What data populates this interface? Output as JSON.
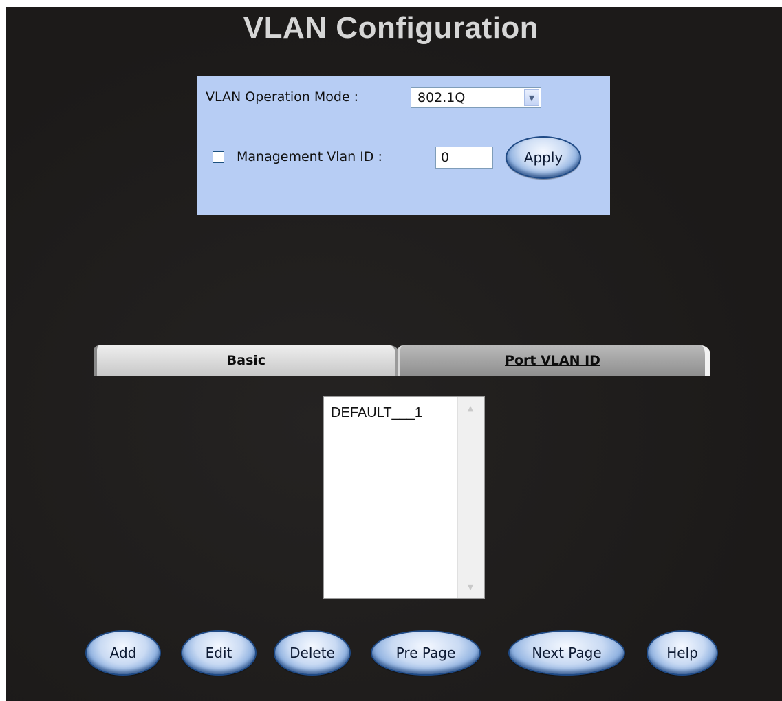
{
  "page": {
    "title": "VLAN Configuration"
  },
  "config": {
    "mode_label": "VLAN Operation Mode :",
    "mode_value": "802.1Q",
    "mgmt_label": "Management Vlan ID :",
    "mgmt_checked": false,
    "mgmt_value": "0",
    "apply_label": "Apply"
  },
  "tabs": [
    {
      "label": "Basic",
      "active": false
    },
    {
      "label": "Port VLAN ID",
      "active": true
    }
  ],
  "vlan_list": {
    "items": [
      "DEFAULT___1"
    ]
  },
  "actions": {
    "add": "Add",
    "edit": "Edit",
    "delete": "Delete",
    "pre_page": "Pre Page",
    "next_page": "Next Page",
    "help": "Help"
  },
  "colors": {
    "background": "#1e1c1b",
    "config_box": "#b7cdf4",
    "title": "#d6d6d6"
  },
  "icons": {
    "select_arrow": "chevron-down-icon",
    "scroll_up": "scroll-up-arrow-icon",
    "scroll_down": "scroll-down-arrow-icon"
  }
}
